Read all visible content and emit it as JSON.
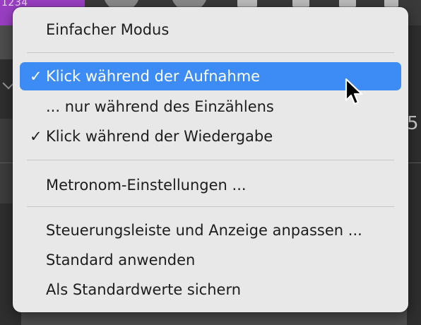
{
  "background": {
    "lcd_text": "1234",
    "bg_digit": "5"
  },
  "menu": {
    "items": [
      {
        "label": "Einfacher Modus",
        "checked": false,
        "selected": false
      },
      {
        "label": "Klick während der Aufnahme",
        "checked": true,
        "selected": true
      },
      {
        "label": "... nur während des Einzählens",
        "checked": false,
        "selected": false
      },
      {
        "label": "Klick während der Wiedergabe",
        "checked": true,
        "selected": false
      },
      {
        "label": "Metronom-Einstellungen ...",
        "checked": false,
        "selected": false
      },
      {
        "label": "Steuerungsleiste und Anzeige anpassen ...",
        "checked": false,
        "selected": false
      },
      {
        "label": "Standard anwenden",
        "checked": false,
        "selected": false
      },
      {
        "label": "Als Standardwerte sichern",
        "checked": false,
        "selected": false
      }
    ],
    "check_glyph": "✓"
  },
  "colors": {
    "highlight": "#3d8cf5",
    "menu_bg": "#e8e8e8",
    "lcd_purple": "#9a3fc4"
  },
  "icons": {
    "cursor": "pointer-cursor-icon",
    "check": "checkmark-icon"
  }
}
